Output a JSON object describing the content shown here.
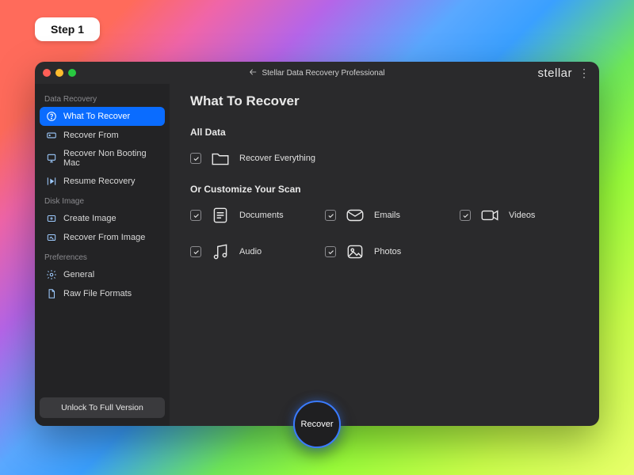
{
  "step_badge": "Step 1",
  "titlebar": {
    "app_title": "Stellar Data Recovery Professional",
    "brand": "stellar"
  },
  "sidebar": {
    "sections": [
      {
        "label": "Data Recovery",
        "items": [
          {
            "label": "What To Recover",
            "icon": "question-circle-icon",
            "active": true
          },
          {
            "label": "Recover From",
            "icon": "drive-icon"
          },
          {
            "label": "Recover Non Booting Mac",
            "icon": "mac-icon"
          },
          {
            "label": "Resume Recovery",
            "icon": "resume-icon"
          }
        ]
      },
      {
        "label": "Disk Image",
        "items": [
          {
            "label": "Create Image",
            "icon": "create-image-icon"
          },
          {
            "label": "Recover From Image",
            "icon": "recover-image-icon"
          }
        ]
      },
      {
        "label": "Preferences",
        "items": [
          {
            "label": "General",
            "icon": "gear-icon"
          },
          {
            "label": "Raw File Formats",
            "icon": "raw-file-icon"
          }
        ]
      }
    ],
    "unlock_label": "Unlock To Full Version"
  },
  "main": {
    "heading": "What To Recover",
    "all_data_label": "All Data",
    "recover_everything_label": "Recover Everything",
    "customize_label": "Or Customize Your Scan",
    "options": [
      {
        "label": "Documents",
        "icon": "documents-icon",
        "checked": true
      },
      {
        "label": "Emails",
        "icon": "emails-icon",
        "checked": true
      },
      {
        "label": "Videos",
        "icon": "videos-icon",
        "checked": true
      },
      {
        "label": "Audio",
        "icon": "audio-icon",
        "checked": true
      },
      {
        "label": "Photos",
        "icon": "photos-icon",
        "checked": true
      }
    ],
    "recover_button": "Recover"
  }
}
